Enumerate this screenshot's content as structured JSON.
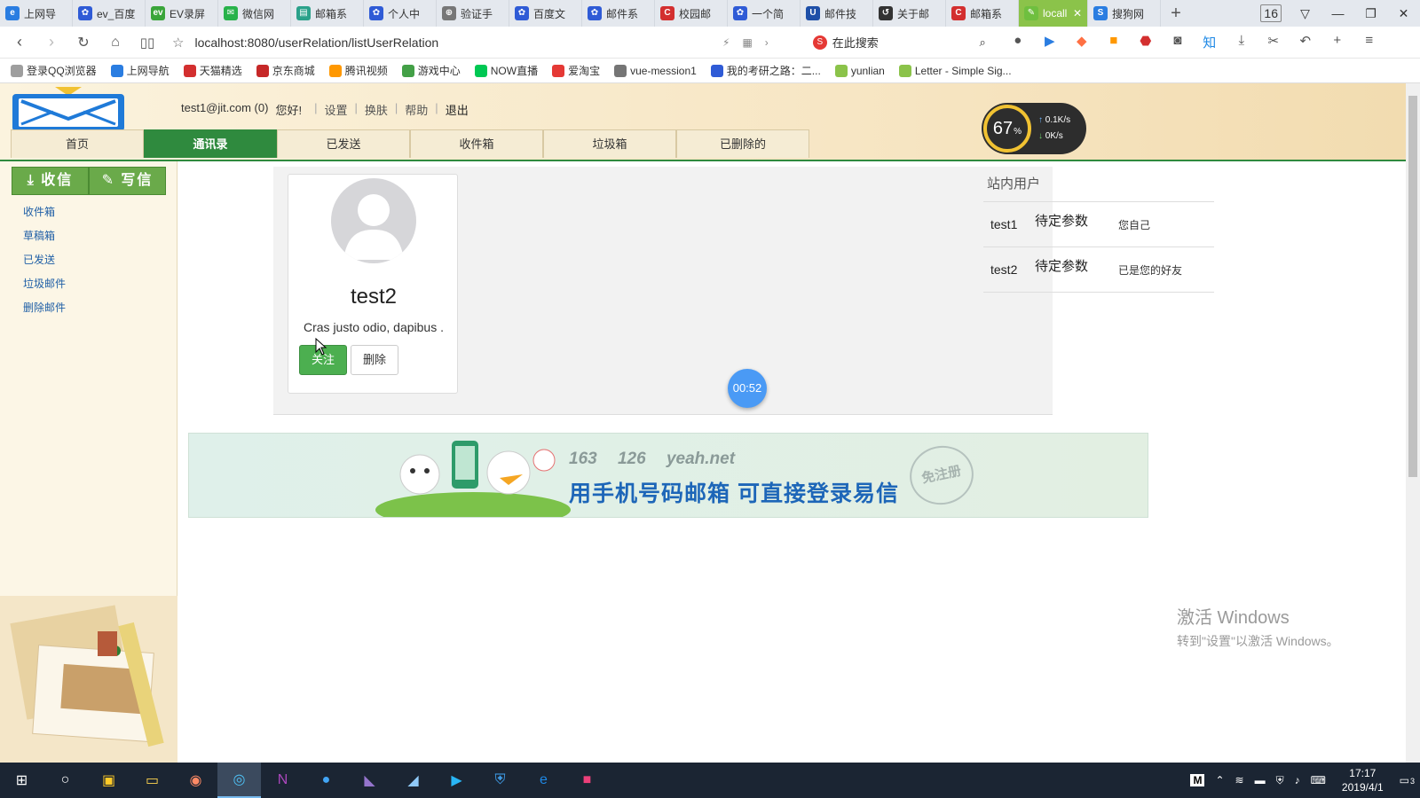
{
  "browser": {
    "tabs": [
      {
        "label": "上网导",
        "color": "#2a7de1",
        "glyph": "e"
      },
      {
        "label": "ev_百度",
        "color": "#2f5bd6",
        "glyph": "✿"
      },
      {
        "label": "EV录屏",
        "color": "#3aa53a",
        "glyph": "ev"
      },
      {
        "label": "微信网",
        "color": "#28b24a",
        "glyph": "✉"
      },
      {
        "label": "邮箱系",
        "color": "#2aa18a",
        "glyph": "▤"
      },
      {
        "label": "个人中",
        "color": "#2f5bd6",
        "glyph": "✿"
      },
      {
        "label": "验证手",
        "color": "#777777",
        "glyph": "⊕"
      },
      {
        "label": "百度文",
        "color": "#2f5bd6",
        "glyph": "✿"
      },
      {
        "label": "邮件系",
        "color": "#2f5bd6",
        "glyph": "✿"
      },
      {
        "label": "校园邮",
        "color": "#d32f2f",
        "glyph": "C"
      },
      {
        "label": "一个简",
        "color": "#2f5bd6",
        "glyph": "✿"
      },
      {
        "label": "邮件技",
        "color": "#1e4fa8",
        "glyph": "U"
      },
      {
        "label": "关于邮",
        "color": "#333333",
        "glyph": "↺"
      },
      {
        "label": "邮箱系",
        "color": "#d32f2f",
        "glyph": "C"
      },
      {
        "label": "locall",
        "color": "#6fbf3f",
        "glyph": "✎",
        "active": true
      },
      {
        "label": "搜狗网",
        "color": "#2a7de1",
        "glyph": "S"
      }
    ],
    "tab_count": "16",
    "url": "localhost:8080/userRelation/listUserRelation",
    "search_placeholder": "在此搜索",
    "bookmarks": [
      {
        "label": "登录QQ浏览器",
        "color": "#9e9e9e"
      },
      {
        "label": "上网导航",
        "color": "#2a7de1"
      },
      {
        "label": "天猫精选",
        "color": "#d32f2f"
      },
      {
        "label": "京东商城",
        "color": "#c62828"
      },
      {
        "label": "腾讯视频",
        "color": "#ff9800"
      },
      {
        "label": "游戏中心",
        "color": "#43a047"
      },
      {
        "label": "NOW直播",
        "color": "#00c853"
      },
      {
        "label": "爱淘宝",
        "color": "#e53935"
      },
      {
        "label": "vue-mession1",
        "color": "#757575"
      },
      {
        "label": "我的考研之路：二...",
        "color": "#2f5bd6"
      },
      {
        "label": "yunlian",
        "color": "#8bc34a"
      },
      {
        "label": "Letter - Simple Sig...",
        "color": "#8bc34a"
      }
    ]
  },
  "header": {
    "user": "test1@jit.com (0)",
    "greeting": "您好!",
    "links": [
      "设置",
      "换肤",
      "帮助",
      "退出"
    ],
    "nav": [
      "首页",
      "通讯录",
      "已发送",
      "收件箱",
      "垃圾箱",
      "已删除的"
    ],
    "active_nav": 1
  },
  "meter": {
    "percent": "67",
    "percent_sign": "%",
    "up": "0.1K/s",
    "down": "0K/s"
  },
  "sidebar": {
    "receive_label": "收信",
    "write_label": "写信",
    "menu": [
      "收件箱",
      "草稿箱",
      "已发送",
      "垃圾邮件",
      "删除邮件"
    ]
  },
  "card": {
    "name": "test2",
    "desc": "Cras justo odio, dapibus .",
    "follow_label": "关注",
    "delete_label": "删除"
  },
  "timer": "00:52",
  "users": {
    "title": "站内用户",
    "rows": [
      {
        "name": "test1",
        "param": "待定参数",
        "status": "您自己"
      },
      {
        "name": "test2",
        "param": "待定参数",
        "status": "已是您的好友"
      }
    ]
  },
  "banner": {
    "brands": [
      "163",
      "126",
      "yeah.net"
    ],
    "headline": "用手机号码邮箱  可直接登录易信",
    "stamp": "免注册"
  },
  "watermark": {
    "line1": "激活 Windows",
    "line2": "转到\"设置\"以激活 Windows。"
  },
  "taskbar": {
    "time": "17:17",
    "date": "2019/4/1",
    "ime": "M",
    "notify_count": "3"
  }
}
